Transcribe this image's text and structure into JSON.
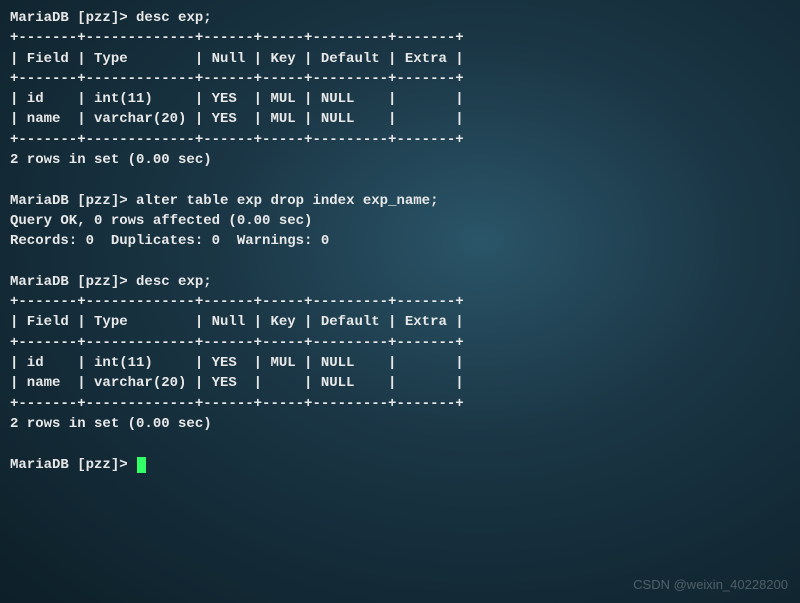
{
  "prompt": "MariaDB [pzz]> ",
  "cmd1": "desc exp;",
  "sep_full": "+-------+-------------+------+-----+---------+-------+",
  "hdr_row": "| Field | Type        | Null | Key | Default | Extra |",
  "r1_id": "| id    | int(11)     | YES  | MUL | NULL    |       |",
  "r1_name": "| name  | varchar(20) | YES  | MUL | NULL    |       |",
  "rows_msg": "2 rows in set (0.00 sec)",
  "cmd2": "alter table exp drop index exp_name;",
  "ok_msg": "Query OK, 0 rows affected (0.00 sec)",
  "records_msg": "Records: 0  Duplicates: 0  Warnings: 0",
  "cmd3": "desc exp;",
  "r2_id": "| id    | int(11)     | YES  | MUL | NULL    |       |",
  "r2_name": "| name  | varchar(20) | YES  |     | NULL    |       |",
  "watermark": "CSDN @weixin_40228200"
}
